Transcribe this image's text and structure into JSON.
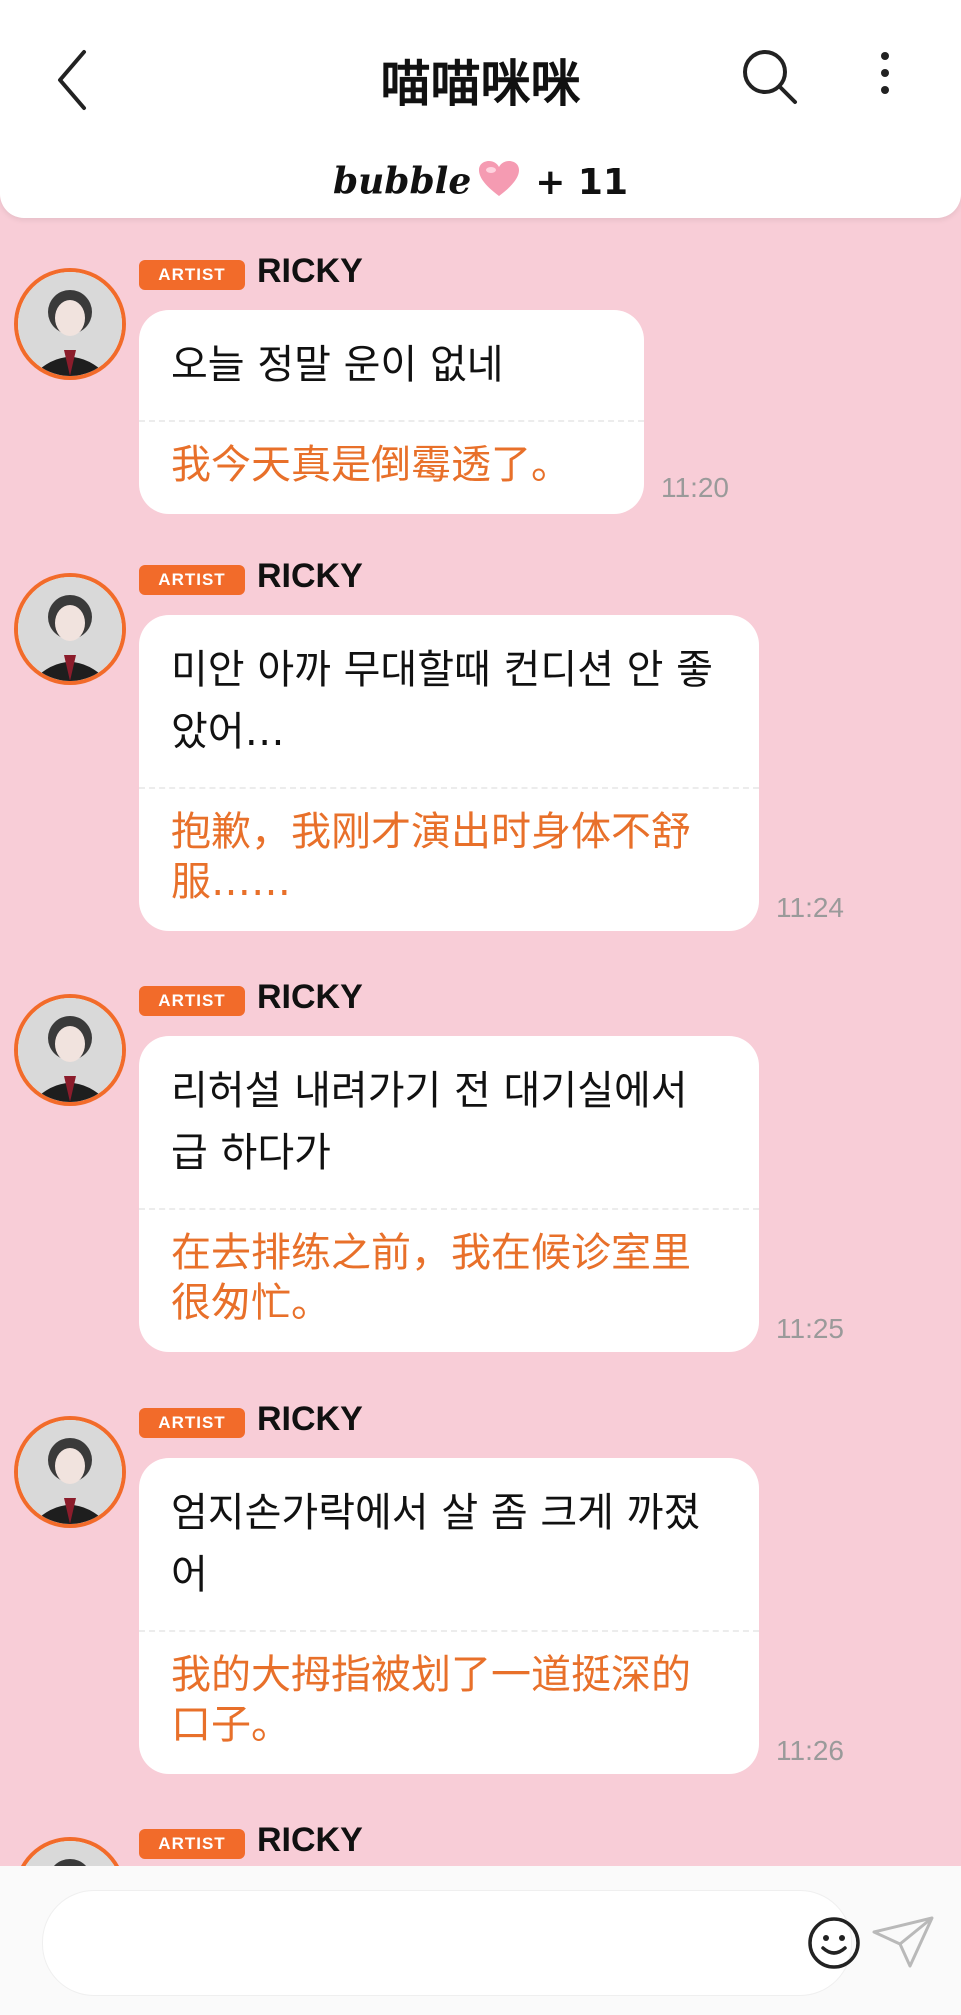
{
  "header": {
    "title": "喵喵咪咪",
    "brand": "bubble",
    "member_count": "+ 11"
  },
  "messages": [
    {
      "badge": "ARTIST",
      "sender": "RICKY",
      "original": "오늘 정말 운이 없네",
      "translation": "我今天真是倒霉透了。",
      "time": "11:20"
    },
    {
      "badge": "ARTIST",
      "sender": "RICKY",
      "original": "미안 아까 무대할때 컨디션 안 좋았어…",
      "translation": "抱歉，我刚才演出时身体不舒服……",
      "time": "11:24"
    },
    {
      "badge": "ARTIST",
      "sender": "RICKY",
      "original": "리허설 내려가기 전 대기실에서 급 하다가",
      "translation": "在去排练之前，我在候诊室里很匆忙。",
      "time": "11:25"
    },
    {
      "badge": "ARTIST",
      "sender": "RICKY",
      "original": "엄지손가락에서 살 좀 크게 까졌어",
      "translation": "我的大拇指被划了一道挺深的口子。",
      "time": "11:26"
    },
    {
      "badge": "ARTIST",
      "sender": "RICKY"
    }
  ],
  "input": {
    "placeholder": ""
  },
  "colors": {
    "background": "#f8cdd7",
    "accent": "#f26b2a",
    "translation_text": "#e8702a"
  },
  "icons": {
    "back": "back-arrow-icon",
    "search": "search-icon",
    "more": "more-vertical-icon",
    "heart": "heart-icon",
    "emoji": "emoji-icon",
    "send": "send-icon"
  }
}
